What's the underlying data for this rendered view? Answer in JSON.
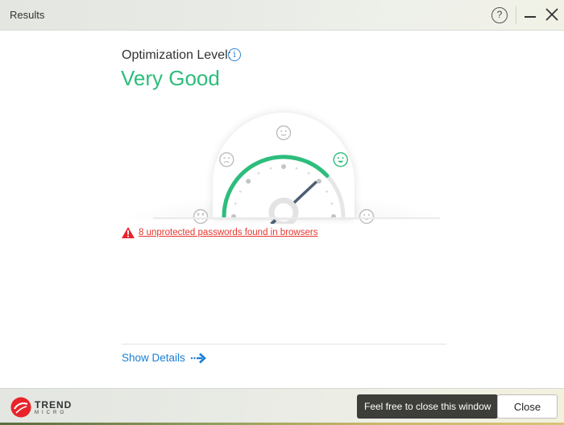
{
  "window": {
    "title": "Results",
    "help_label": "?",
    "help_icon": "question-circle-icon",
    "minimize_icon": "minimize-icon",
    "close_icon": "close-icon"
  },
  "optimization": {
    "label": "Optimization Level:",
    "info_glyph": "i",
    "level": "Very Good",
    "level_color": "#2dbd7c",
    "score_fraction": 0.76,
    "gauge_faces": [
      "angry-face-icon",
      "sad-face-icon",
      "neutral-smile-face-icon",
      "happy-face-icon",
      "very-happy-face-icon"
    ],
    "active_face_index": 3
  },
  "warning": {
    "icon": "warning-triangle-icon",
    "text": "8 unprotected passwords found in browsers",
    "color": "#e8362d"
  },
  "details": {
    "label": "Show Details",
    "icon": "dotted-arrow-right-icon"
  },
  "footer": {
    "brand_line1": "TREND",
    "brand_line2": "MICRO",
    "tooltip": "Feel free to close this window",
    "close_label": "Close"
  }
}
